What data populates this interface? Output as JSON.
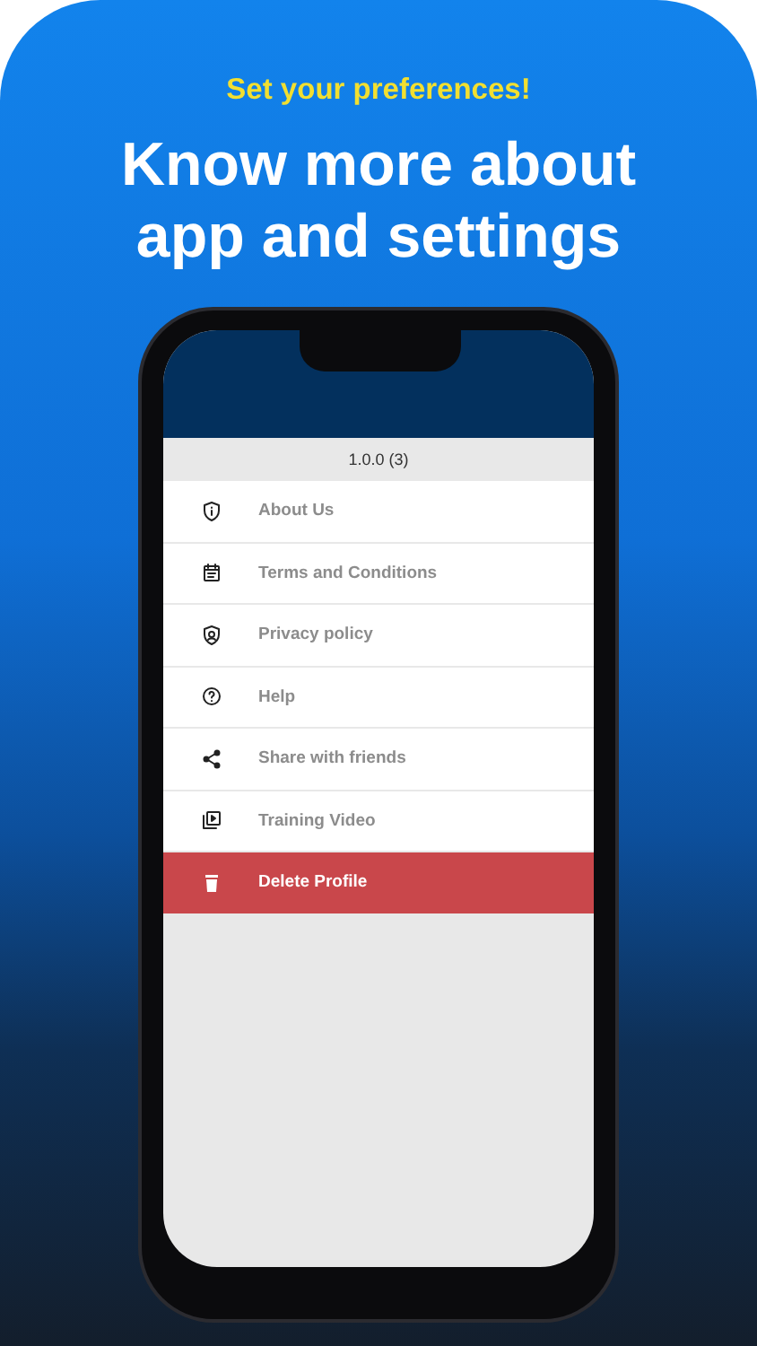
{
  "tagline": "Set your preferences!",
  "headline": "Know more about app and settings",
  "phone_screen": {
    "version": "1.0.0 (3)",
    "menu_items": [
      {
        "label": "About Us",
        "kind": "normal"
      },
      {
        "label": "Terms and Conditions",
        "kind": "normal"
      },
      {
        "label": "Privacy policy",
        "kind": "normal"
      },
      {
        "label": "Help",
        "kind": "normal"
      },
      {
        "label": "Share with friends",
        "kind": "normal"
      },
      {
        "label": "Training Video",
        "kind": "normal"
      },
      {
        "label": "Delete Profile",
        "kind": "danger"
      }
    ]
  }
}
